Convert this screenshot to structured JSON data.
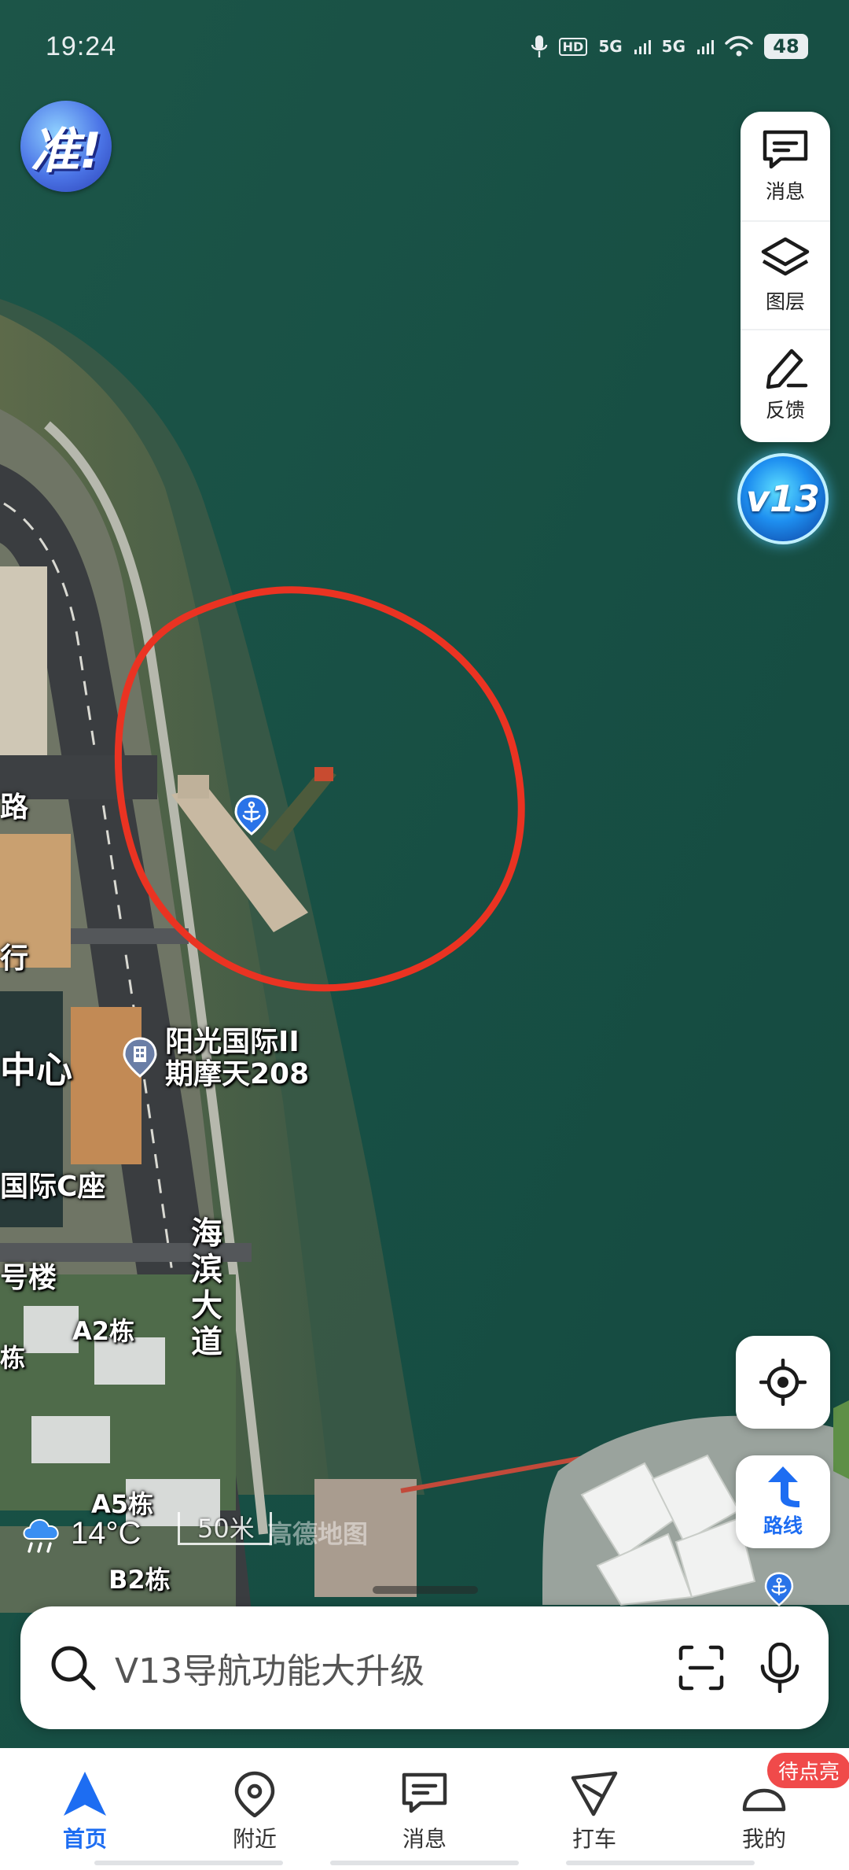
{
  "status_bar": {
    "time": "19:24",
    "signal_left": "5G",
    "signal_right": "5G",
    "hd_label": "HD",
    "battery": "48"
  },
  "brand": {
    "badge_text": "准!"
  },
  "tools": {
    "messages_label": "消息",
    "layers_label": "图层",
    "feedback_label": "反馈",
    "version_badge": "v13"
  },
  "map": {
    "labels": {
      "road_partial": "路",
      "bank_partial": "行",
      "center_partial": "中心",
      "poi_sunshine": "阳光国际II\n期摩天208",
      "building_c": "国际C座",
      "building_hao": "号楼",
      "building_a2": "A2栋",
      "building_dong": "栋",
      "building_a5": "A5栋",
      "building_b2": "B2栋",
      "road_haibin": "海滨大道"
    },
    "accent_colors": {
      "annotation_circle": "#ea3322",
      "poi_blue": "#2a73e8",
      "water": "#174f44"
    }
  },
  "controls": {
    "route_label": "路线"
  },
  "weather": {
    "temperature": "14°C",
    "icon": "rain-cloud-icon"
  },
  "scale": {
    "label": "50米",
    "watermark": "高德地图"
  },
  "search": {
    "placeholder": "V13导航功能大升级"
  },
  "bottom_nav": {
    "items": [
      {
        "label": "首页",
        "icon": "navigation-arrow-icon",
        "active": true
      },
      {
        "label": "附近",
        "icon": "location-pin-icon",
        "active": false
      },
      {
        "label": "消息",
        "icon": "message-icon",
        "active": false
      },
      {
        "label": "打车",
        "icon": "taxi-icon",
        "active": false
      },
      {
        "label": "我的",
        "icon": "profile-icon",
        "active": false
      }
    ],
    "badge": "待点亮"
  }
}
